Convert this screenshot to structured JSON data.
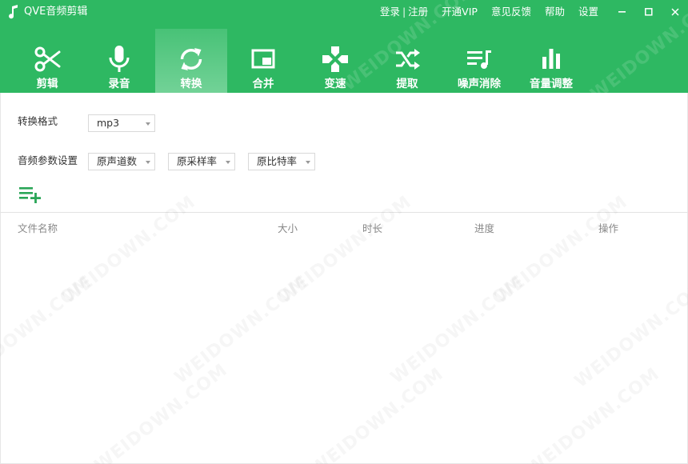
{
  "app": {
    "title": "QVE音频剪辑",
    "icon": "music-note-icon"
  },
  "top_links": {
    "login": "登录",
    "separator": "|",
    "register": "注册",
    "vip": "开通VIP",
    "feedback": "意见反馈",
    "help": "帮助",
    "settings": "设置"
  },
  "window_controls": [
    "minimize-icon",
    "maximize-icon",
    "close-icon"
  ],
  "toolbar": {
    "active": "转换",
    "items": [
      {
        "label": "剪辑",
        "icon": "scissors-icon"
      },
      {
        "label": "录音",
        "icon": "microphone-icon"
      },
      {
        "label": "转换",
        "icon": "convert-arrows-icon"
      },
      {
        "label": "合并",
        "icon": "merge-window-icon"
      },
      {
        "label": "变速",
        "icon": "speed-dpad-icon"
      },
      {
        "label": "提取",
        "icon": "shuffle-icon"
      },
      {
        "label": "噪声消除",
        "icon": "playlist-music-icon"
      },
      {
        "label": "音量调整",
        "icon": "equalizer-bars-icon"
      }
    ]
  },
  "convert": {
    "format_label": "转换格式",
    "format_value": "mp3",
    "params_label": "音频参数设置",
    "channels_value": "原声道数",
    "samplerate_value": "原采样率",
    "bitrate_value": "原比特率",
    "add_icon": "playlist-add-icon"
  },
  "table": {
    "columns": [
      "文件名称",
      "大小",
      "时长",
      "进度",
      "操作"
    ]
  },
  "watermark": "WEIDOWN.COM",
  "colors": {
    "brand_green": "#2eb862",
    "add_icon_green": "#2aa557",
    "header_text": "#888888"
  }
}
